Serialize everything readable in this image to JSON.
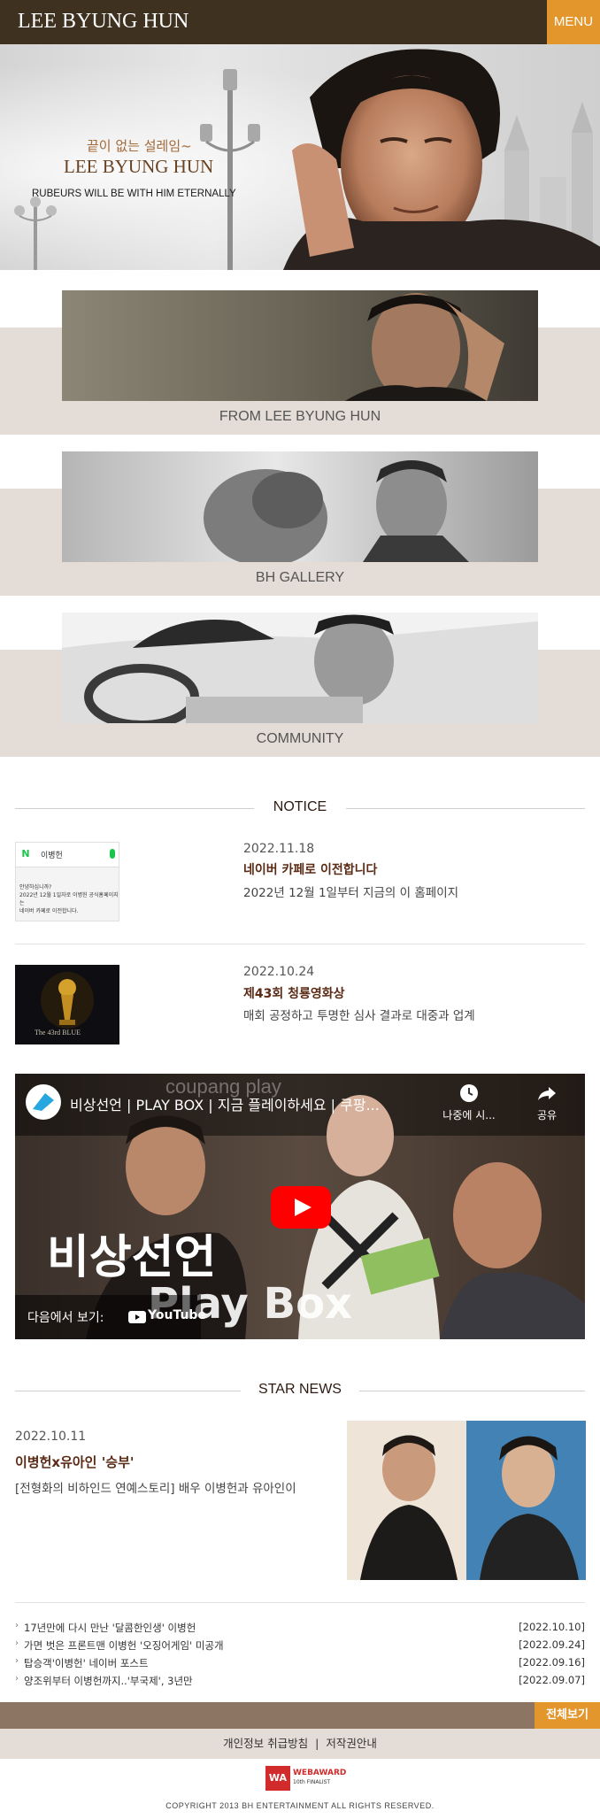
{
  "header": {
    "logo": "LEE BYUNG HUN",
    "menu_label": "MENU"
  },
  "hero": {
    "tagline": "끝이 없는 설레임~",
    "name": "LEE BYUNG HUN",
    "sub": "RUBEURS WILL BE WITH HIM ETERNALLY"
  },
  "features": [
    {
      "label": "FROM LEE BYUNG HUN"
    },
    {
      "label": "BH GALLERY"
    },
    {
      "label": "COMMUNITY"
    }
  ],
  "notice": {
    "title": "NOTICE",
    "items": [
      {
        "date": "2022.11.18",
        "title": "네이버 카페로 이전합니다",
        "desc": "2022년 12월 1일부터 지금의 이 홈페이지",
        "thumb": {
          "app_badge": "N",
          "search_text": "이병헌",
          "line1": "안녕하십니까?",
          "line2": "2022년 12월 1일자로 이병헌 공식홈페이지는",
          "line3": "네이버 카페로 이전합니다."
        }
      },
      {
        "date": "2022.10.24",
        "title": "제43회 청룡영화상",
        "desc": "매회 공정하고 투명한 심사 결과로 대중과 업계",
        "thumb": {
          "caption": "The 43rd BLUE"
        }
      }
    ]
  },
  "video": {
    "title": "비상선언 | PLAY BOX | 지금 플레이하세요 | 쿠팡...",
    "watermark": "coupang play",
    "watch_later": "나중에 시...",
    "share": "공유",
    "watch_on": "다음에서 보기:",
    "youtube": "YouTube",
    "big_title": "비상선언",
    "big_sub": "Play Box"
  },
  "star_news": {
    "title": "STAR NEWS",
    "date": "2022.10.11",
    "headline": "이병헌x유아인 '승부'",
    "desc": "[전형화의 비하인드 연예스토리] 배우 이병헌과 유아인이",
    "list": [
      {
        "text": "17년만에 다시 만난 '달콤한인생' 이병헌",
        "date": "[2022.10.10]"
      },
      {
        "text": "가면 벗은 프론트맨 이병헌 '오징어게임' 미공개",
        "date": "[2022.09.24]"
      },
      {
        "text": "탑승객'이병헌' 네이버 포스트",
        "date": "[2022.09.16]"
      },
      {
        "text": "양조위부터 이병헌까지..'부국제', 3년만",
        "date": "[2022.09.07]"
      }
    ]
  },
  "footer": {
    "more": "전체보기",
    "privacy": "개인정보 취급방침",
    "copyright_link": "저작권안내",
    "separator": "|",
    "award_logo": "WA",
    "award_title": "WEBAWARD",
    "award_sub": "10th FINALIST",
    "copyright": "COPYRIGHT 2013 BH ENTERTAINMENT ALL RIGHTS RESERVED."
  },
  "colors": {
    "header_bg": "#3f3120",
    "accent": "#e3962b",
    "band": "#e4dcd6",
    "footer_bar": "#8c7663"
  }
}
